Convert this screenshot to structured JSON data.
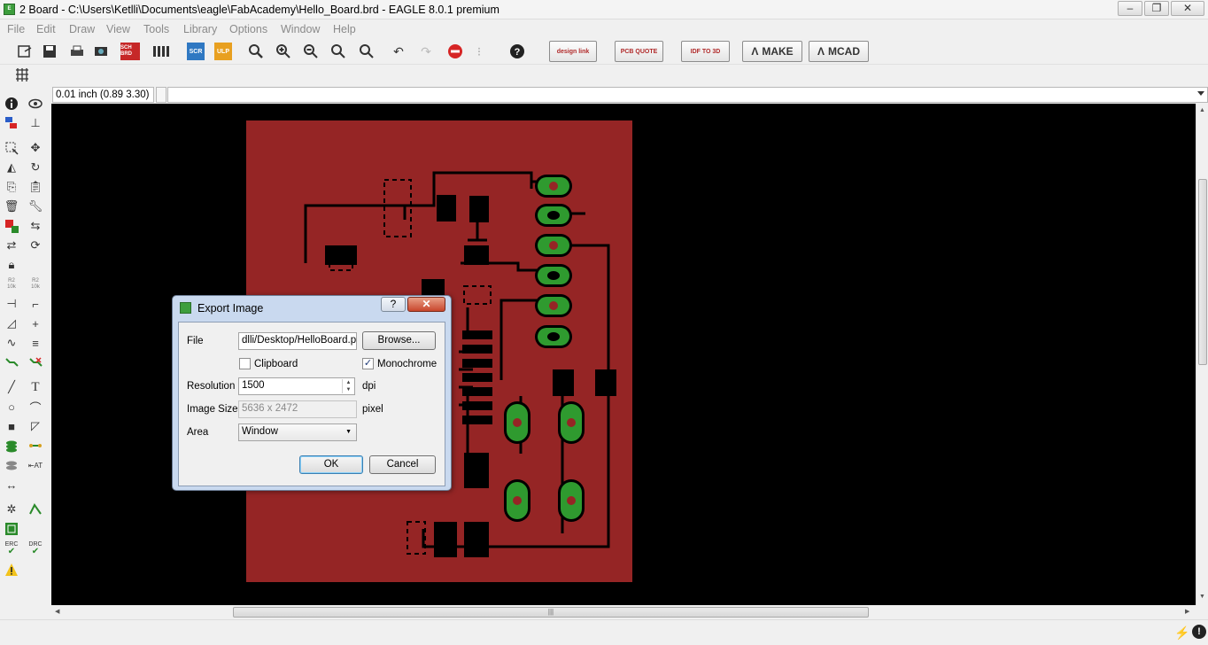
{
  "window": {
    "title": "2 Board - C:\\Users\\Ketlli\\Documents\\eagle\\FabAcademy\\Hello_Board.brd - EAGLE 8.0.1 premium"
  },
  "menu": [
    "File",
    "Edit",
    "Draw",
    "View",
    "Tools",
    "Library",
    "Options",
    "Window",
    "Help"
  ],
  "toolbar": {
    "sch_brd": "SCH BRD",
    "scr": "SCR",
    "ulp": "ULP",
    "brand_buttons": {
      "design_link": "design link",
      "pcb_quote": "PCB QUOTE",
      "idf": "IDF TO 3D",
      "make": "MAKE",
      "mcad": "MCAD"
    }
  },
  "coords": {
    "display": "0.01 inch (0.89 3.30)"
  },
  "lefttools": {
    "erc": "ERC",
    "drc": "DRC",
    "r2": "R2",
    "r2val": "10k"
  },
  "dialog": {
    "title": "Export Image",
    "file_label": "File",
    "file_value": "dlli/Desktop/HelloBoard.png",
    "browse_label": "Browse...",
    "clipboard_label": "Clipboard",
    "clipboard_checked": false,
    "monochrome_label": "Monochrome",
    "monochrome_checked": true,
    "resolution_label": "Resolution",
    "resolution_value": "1500",
    "resolution_unit": "dpi",
    "imagesize_label": "Image Size",
    "imagesize_value": "5636 x 2472",
    "imagesize_unit": "pixel",
    "area_label": "Area",
    "area_value": "Window",
    "ok_label": "OK",
    "cancel_label": "Cancel"
  },
  "colors": {
    "board": "#952525",
    "pad": "#2f9a2f",
    "background": "#000000"
  }
}
